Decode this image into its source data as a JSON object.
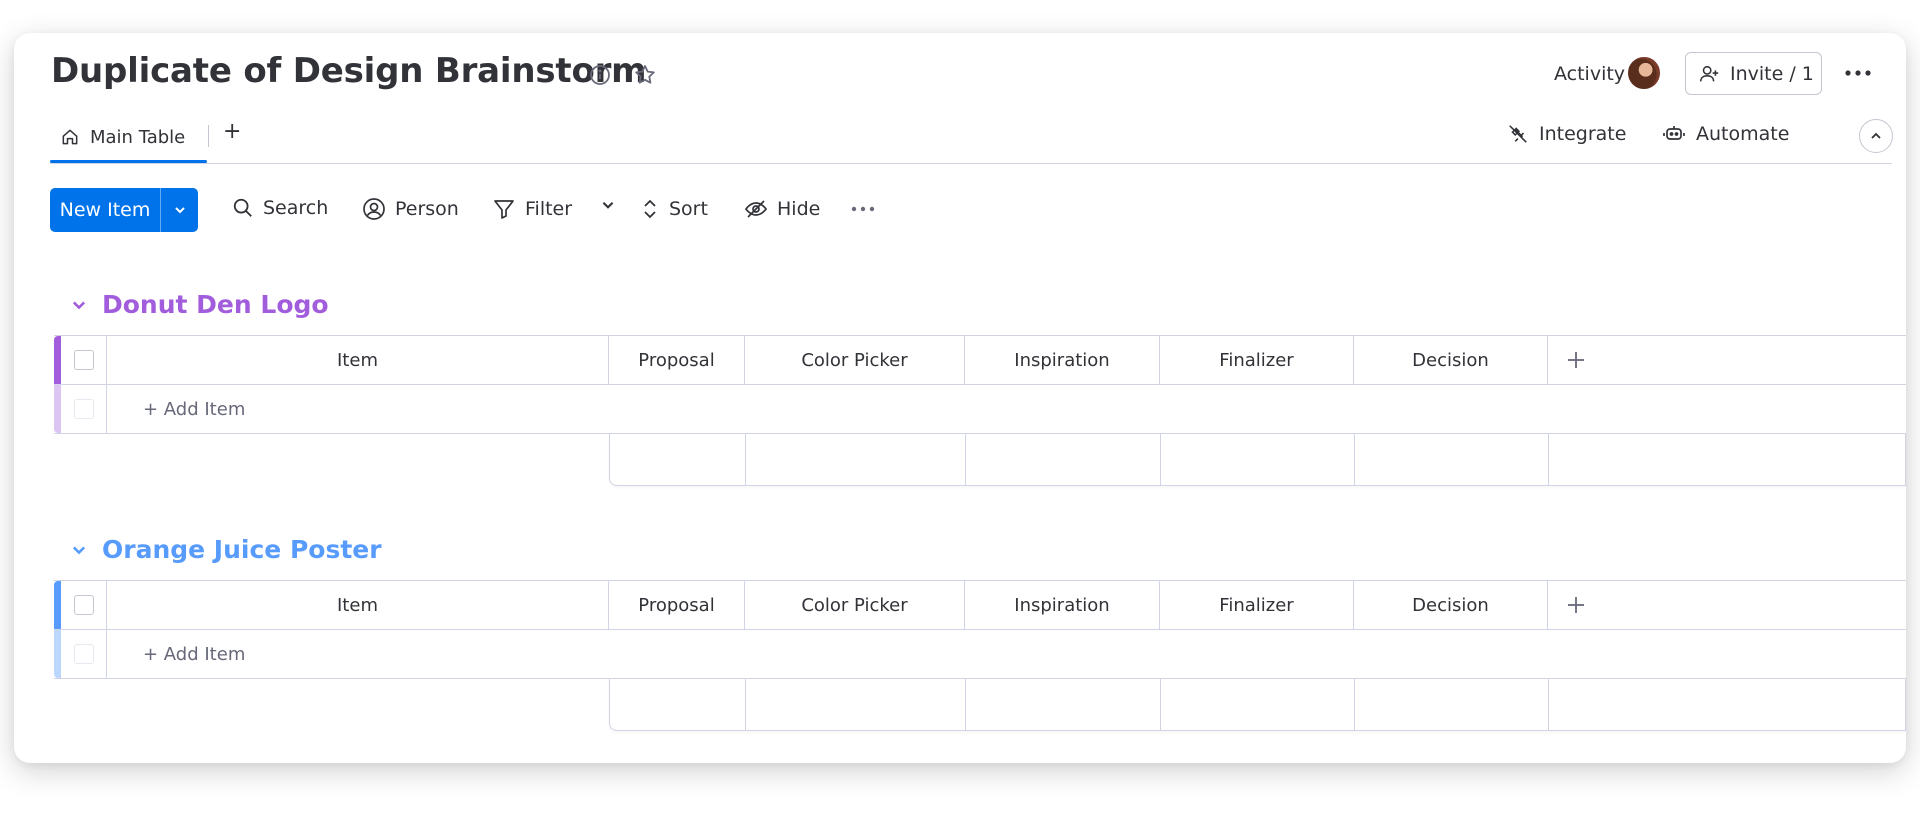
{
  "board": {
    "title": "Duplicate of Design Brainstorm",
    "info_icon": "info-icon",
    "star_icon": "star-icon"
  },
  "header": {
    "activity_label": "Activity",
    "invite_label": "Invite / 1",
    "more_icon": "more-horizontal-icon"
  },
  "tabs": {
    "main_label": "Main Table",
    "add_label": "+"
  },
  "actions": {
    "integrate_label": "Integrate",
    "automate_label": "Automate"
  },
  "toolbar": {
    "new_item_label": "New Item",
    "search_label": "Search",
    "person_label": "Person",
    "filter_label": "Filter",
    "sort_label": "Sort",
    "hide_label": "Hide"
  },
  "columns": [
    "Item",
    "Proposal",
    "Color Picker",
    "Inspiration",
    "Finalizer",
    "Decision"
  ],
  "add_column_label": "+",
  "add_item_label": "+ Add Item",
  "groups": [
    {
      "title": "Donut Den Logo",
      "color": "#a25ddc",
      "light_color": "#dcc4f3"
    },
    {
      "title": "Orange Juice Poster",
      "color": "#579bfc",
      "light_color": "#bcd7fe"
    }
  ],
  "colors": {
    "primary": "#0073ea",
    "text": "#323338",
    "border": "#d0d4e4"
  }
}
